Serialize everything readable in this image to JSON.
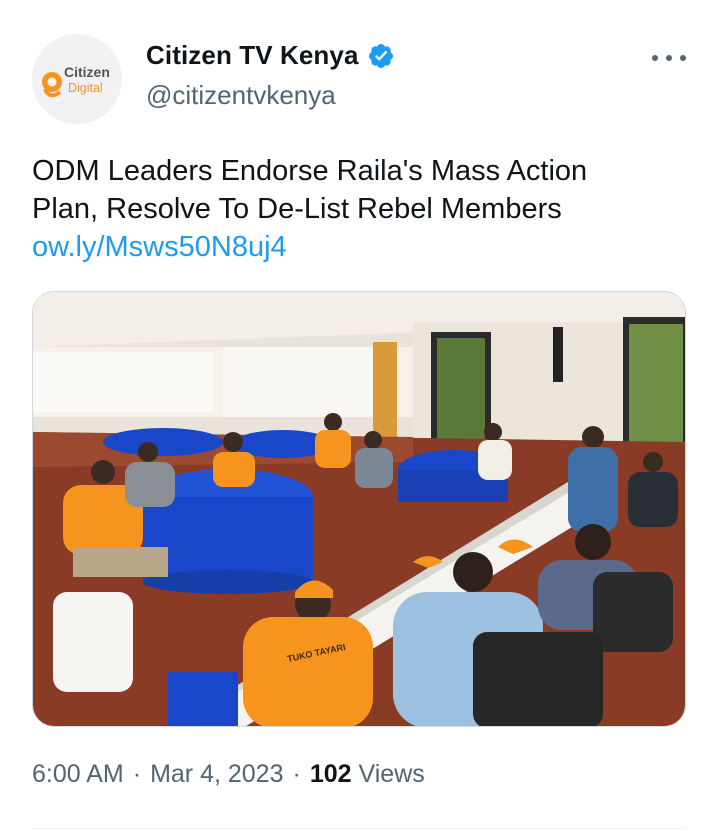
{
  "author": {
    "display_name": "Citizen TV Kenya",
    "handle": "@citizentvkenya",
    "avatar": {
      "logo_top": "Citizen",
      "logo_bottom": "Digital"
    },
    "verified_icon": "verified-badge-icon"
  },
  "menu_icon": "more-icon",
  "tweet": {
    "text_line1": "ODM Leaders Endorse Raila's Mass Action",
    "text_line2": "Plan, Resolve To De-List Rebel Members",
    "link": "ow.ly/Msws50N8uj4"
  },
  "media": {
    "shirt_text": "TUKO TAYARI"
  },
  "footer": {
    "time": "6:00 AM",
    "separator1": "·",
    "date": "Mar 4, 2023",
    "separator2": "·",
    "views_count": "102",
    "views_label": "Views"
  },
  "colors": {
    "accent": "#1d9bf0",
    "text": "#0f1419",
    "secondary": "#536471",
    "odm_orange": "#f7941d",
    "table_blue": "#1a47c9"
  }
}
